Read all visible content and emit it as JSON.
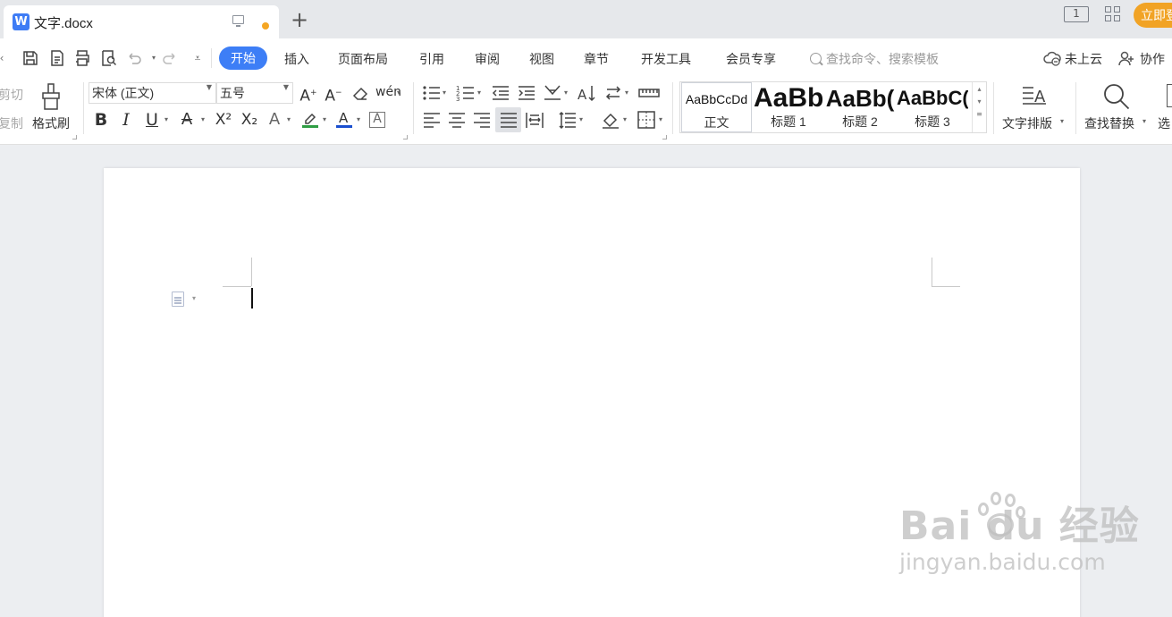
{
  "tab": {
    "title": "文字.docx"
  },
  "window": {
    "layout_indicator": "1",
    "vip_button": "立即登"
  },
  "menu": {
    "active": "开始",
    "items": [
      "插入",
      "页面布局",
      "引用",
      "审阅",
      "视图",
      "章节",
      "开发工具",
      "会员专享"
    ],
    "search_placeholder": "查找命令、搜索模板",
    "cloud": "未上云",
    "collab": "协作"
  },
  "clipboard": {
    "cut": "剪切",
    "copy": "复制",
    "format_painter": "格式刷"
  },
  "font": {
    "name": "宋体 (正文)",
    "size": "五号",
    "bold": "B",
    "italic": "I",
    "underline": "U",
    "strike": "A",
    "superscript": "X²",
    "subscript": "X₂",
    "effects": "A",
    "highlight_color": "#2f9e44",
    "font_color": "#1a4fcf",
    "char_border": "A"
  },
  "styles": [
    {
      "preview": "AaBbCcDd",
      "label": "正文"
    },
    {
      "preview": "AaBb",
      "label": "标题 1"
    },
    {
      "preview": "AaBb(",
      "label": "标题 2"
    },
    {
      "preview": "AaBbC(",
      "label": "标题 3"
    }
  ],
  "tools": {
    "text_layout": "文字排版",
    "find_replace": "查找替换",
    "select": "选"
  },
  "watermark": {
    "brand": "Bai du 经验",
    "url": "jingyan.baidu.com"
  },
  "colors": {
    "accent": "#3d7ef6",
    "vip": "#f1a325",
    "unsaved_dot": "#f5a623"
  }
}
